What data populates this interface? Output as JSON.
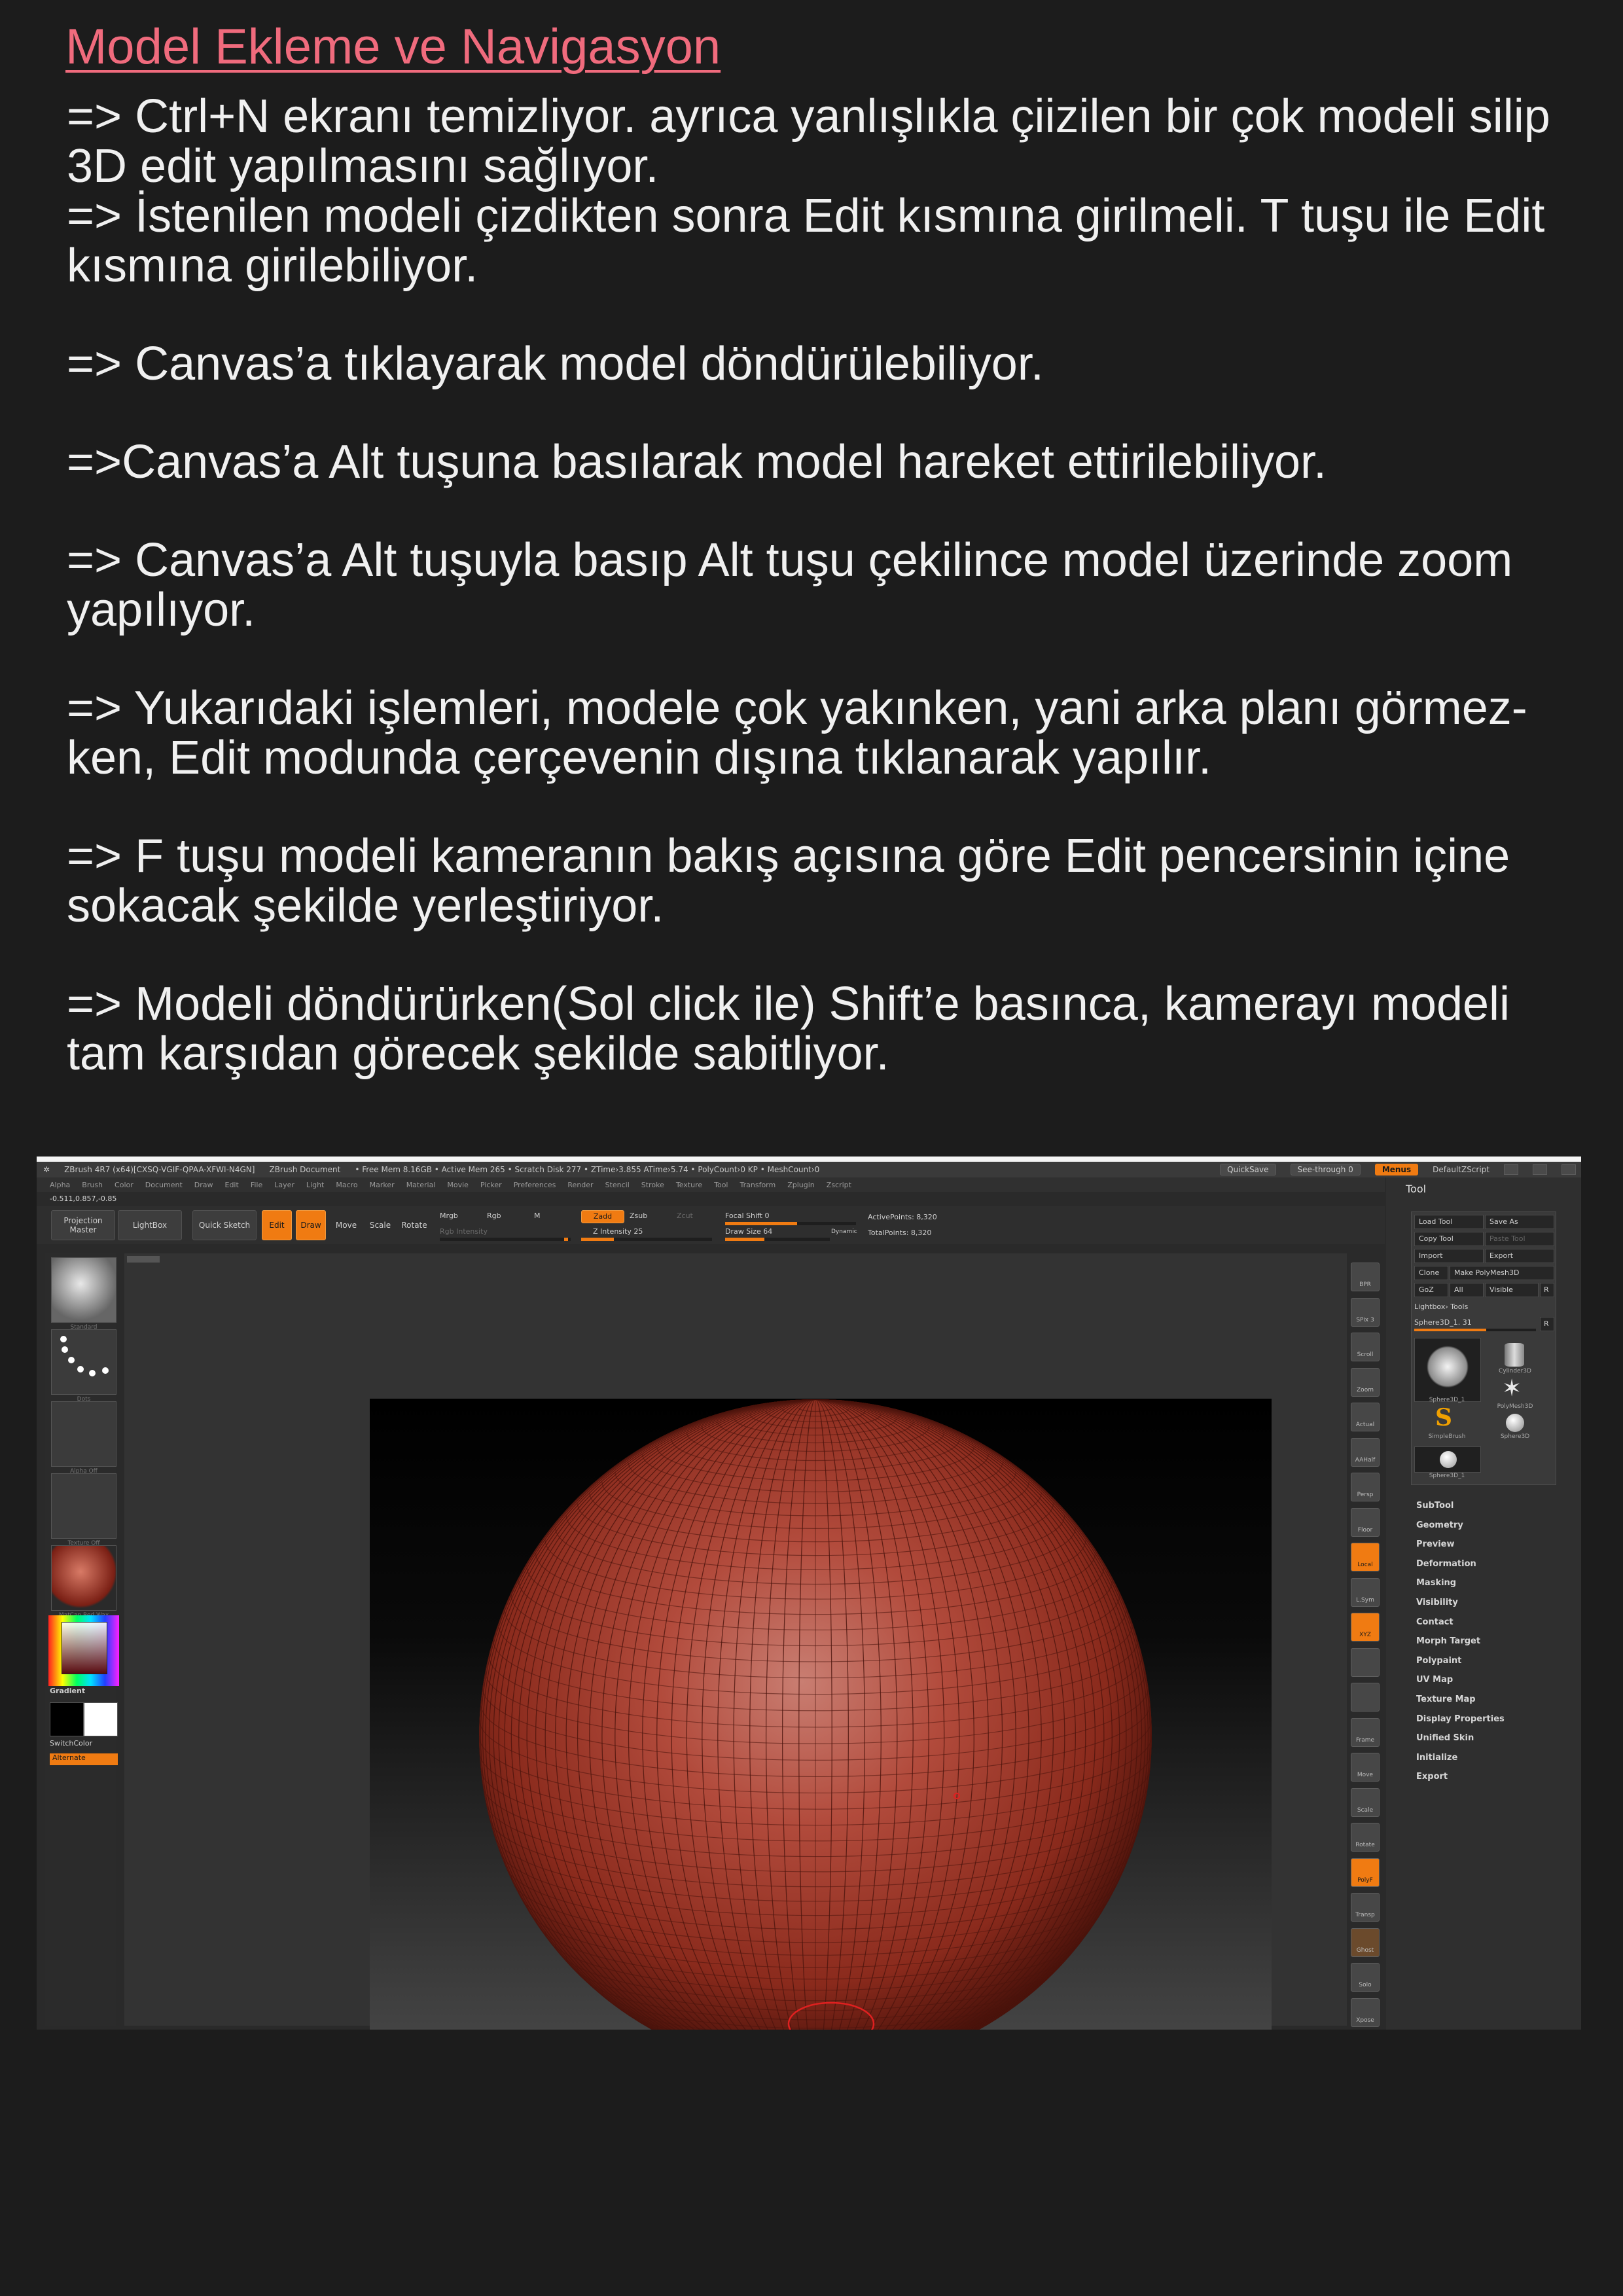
{
  "doc": {
    "title": "Model Ekleme ve Navigasyon",
    "notes": [
      "=> Ctrl+N ekranı temizliyor. ayrıca yanlışlıkla çiizilen bir çok modeli silip 3D edit yapılmasını sağlıyor.",
      "=> İstenilen modeli çizdikten sonra Edit kısmına girilmeli. T tuşu ile Edit kısmına girilebiliyor.",
      "=> Canvas’a tıklayarak model döndürülebiliyor.",
      "=>Canvas’a Alt tuşuna basılarak model hareket ettirilebiliyor.",
      "=> Canvas’a Alt tuşuyla basıp Alt tuşu çekilince model üzerinde zoom yapılıyor.",
      "=> Yukarıdaki işlemleri, modele çok yakınken, yani arka planı görmez-ken, Edit modunda çerçevenin dışına tıklanarak yapılır.",
      "=> F tuşu modeli kameranın bakış açısına göre Edit pencersinin içine sokacak şekilde yerleştiriyor.",
      "=> Modeli döndürürken(Sol click ile) Shift’e basınca, kamerayı modeli tam karşıdan görecek şekilde sabitliyor."
    ]
  },
  "zbrush": {
    "titlebar": {
      "app": "ZBrush 4R7 (x64)[CXSQ-VGIF-QPAA-XFWI-N4GN]",
      "document": "ZBrush Document",
      "stats": "• Free Mem 8.16GB • Active Mem 265 • Scratch Disk 277 • ZTime›3.855 ATime›5.74 • PolyCount›0 KP • MeshCount›0",
      "quicksave": "QuickSave",
      "seethrough": "See-through 0",
      "menus": "Menus",
      "script": "DefaultZScript"
    },
    "menu": [
      "Alpha",
      "Brush",
      "Color",
      "Document",
      "Draw",
      "Edit",
      "File",
      "Layer",
      "Light",
      "Macro",
      "Marker",
      "Material",
      "Movie",
      "Picker",
      "Preferences",
      "Render",
      "Stencil",
      "Stroke",
      "Texture",
      "Tool",
      "Transform",
      "Zplugin",
      "Zscript"
    ],
    "coords": "-0.511,0.857,-0.85",
    "shelf": {
      "projection": "Projection Master",
      "lightbox": "LightBox",
      "quicksketch": "Quick Sketch",
      "edit": "Edit",
      "draw": "Draw",
      "move": "Move",
      "scale": "Scale",
      "rotate": "Rotate",
      "mrgb": "Mrgb",
      "rgb": "Rgb",
      "m": "M",
      "rgb_intensity": "Rgb Intensity",
      "zadd": "Zadd",
      "zsub": "Zsub",
      "zcut": "Zcut",
      "z_intensity": "Z Intensity 25",
      "focal_shift": "Focal Shift 0",
      "draw_size": "Draw Size 64",
      "dynamic": "Dynamic",
      "active_points": "ActivePoints: 8,320",
      "total_points": "TotalPoints: 8,320"
    },
    "left": {
      "brush": "Standard",
      "stroke": "Dots",
      "alpha": "Alpha Off",
      "texture": "Texture Off",
      "material": "MatCap Red Wax",
      "gradient": "Gradient",
      "switchcolor": "SwitchColor",
      "alternate": "Alternate"
    },
    "right_shelf": [
      "BPR",
      "SPix 3",
      "Scroll",
      "Zoom",
      "Actual",
      "AAHalf",
      "Persp",
      "Floor",
      "Local",
      "L.Sym",
      "XYZ",
      "",
      "",
      "Frame",
      "Move",
      "Scale",
      "Rotate",
      "PolyF",
      "Transp",
      "Ghost",
      "Solo",
      "Xpose"
    ],
    "tool": {
      "header": "Tool",
      "buttons": [
        "Load Tool",
        "Save As",
        "Copy Tool",
        "Paste Tool",
        "Import",
        "Export",
        "Clone",
        "Make PolyMesh3D",
        "GoZ",
        "All",
        "Visible",
        "R"
      ],
      "lightbox_tools": "Lightbox› Tools",
      "current": "Sphere3D_1. 31",
      "r": "R",
      "thumbs": [
        "Sphere3D_1",
        "Cylinder3D",
        "PolyMesh3D",
        "SimpleBrush",
        "Sphere3D",
        "Sphere3D_1"
      ],
      "sections": [
        "SubTool",
        "Geometry",
        "Preview",
        "Deformation",
        "Masking",
        "Visibility",
        "Contact",
        "Morph Target",
        "Polypaint",
        "UV Map",
        "Texture Map",
        "Display Properties",
        "Unified Skin",
        "Initialize",
        "Export"
      ]
    },
    "colors": {
      "accent": "#f07b12",
      "model": "#b8483c",
      "title_pink": "#f06b7d"
    }
  }
}
